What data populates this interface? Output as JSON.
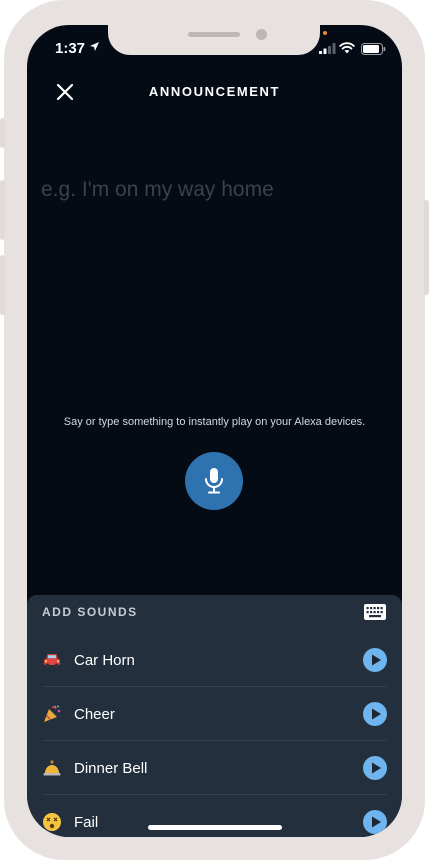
{
  "status_bar": {
    "time": "1:37"
  },
  "header": {
    "title": "ANNOUNCEMENT",
    "close_icon": "close-icon"
  },
  "announcement": {
    "placeholder": "e.g. I'm on my way home",
    "value": "",
    "helper_text": "Say or type something to instantly play on your Alexa devices.",
    "mic_icon": "microphone-icon"
  },
  "sounds": {
    "title": "ADD SOUNDS",
    "keyboard_icon": "keyboard-icon",
    "items": [
      {
        "label": "Car Horn",
        "icon": "car-icon"
      },
      {
        "label": "Cheer",
        "icon": "party-popper-icon"
      },
      {
        "label": "Dinner Bell",
        "icon": "bell-icon"
      },
      {
        "label": "Fail",
        "icon": "dizzy-face-icon"
      }
    ]
  },
  "colors": {
    "background": "#050b14",
    "sheet": "#232f3c",
    "accent": "#2f72b0",
    "play": "#6eb5f0"
  }
}
